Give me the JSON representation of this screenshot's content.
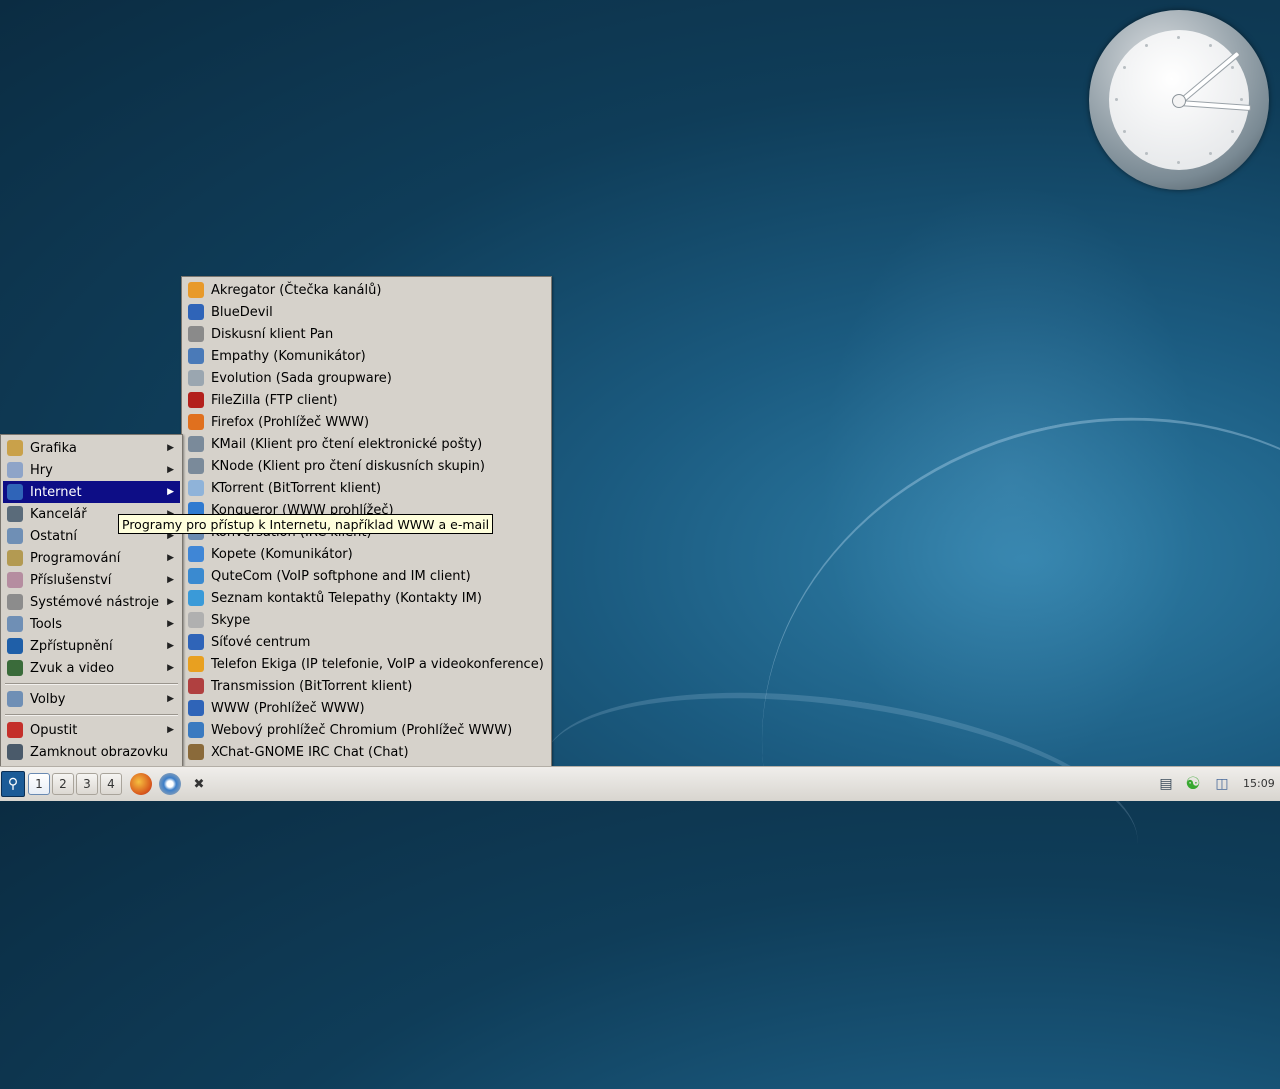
{
  "main_menu": {
    "items": [
      {
        "label": "Grafika",
        "icon": "graphics-icon",
        "color": "#c9a14a",
        "submenu": true
      },
      {
        "label": "Hry",
        "icon": "games-icon",
        "color": "#8ea4c8",
        "submenu": true
      },
      {
        "label": "Internet",
        "icon": "internet-globe-icon",
        "color": "#2f64b8",
        "submenu": true,
        "active": true
      },
      {
        "label": "Kancelář",
        "icon": "office-icon",
        "color": "#5a6b7a",
        "submenu": true
      },
      {
        "label": "Ostatní",
        "icon": "other-icon",
        "color": "#6f8fb5",
        "submenu": true
      },
      {
        "label": "Programování",
        "icon": "programming-icon",
        "color": "#b39a52",
        "submenu": true
      },
      {
        "label": "Příslušenství",
        "icon": "accessories-icon",
        "color": "#b58da0",
        "submenu": true
      },
      {
        "label": "Systémové nástroje",
        "icon": "system-tools-icon",
        "color": "#8c8c8c",
        "submenu": true
      },
      {
        "label": "Tools",
        "icon": "tools-icon",
        "color": "#6f8fb5",
        "submenu": true
      },
      {
        "label": "Zpřístupnění",
        "icon": "accessibility-icon",
        "color": "#1f5fa8",
        "submenu": true
      },
      {
        "label": "Zvuk a video",
        "icon": "multimedia-icon",
        "color": "#3a6b3a",
        "submenu": true
      }
    ],
    "settings": {
      "label": "Volby",
      "icon": "settings-icon",
      "color": "#6f8fb5"
    },
    "logout": {
      "label": "Opustit",
      "icon": "logout-icon",
      "color": "#c4302b"
    },
    "lock": {
      "label": "Zamknout obrazovku",
      "icon": "lock-screen-icon",
      "color": "#4a5a6a"
    }
  },
  "submenu": {
    "items": [
      {
        "label": "Akregator (Čtečka kanálů)",
        "icon": "akregator-icon",
        "color": "#e89a2a"
      },
      {
        "label": "BlueDevil",
        "icon": "bluetooth-icon",
        "color": "#2f64b8"
      },
      {
        "label": "Diskusní klient Pan",
        "icon": "pan-icon",
        "color": "#8a8a8a"
      },
      {
        "label": "Empathy (Komunikátor)",
        "icon": "empathy-icon",
        "color": "#4a7ab8"
      },
      {
        "label": "Evolution (Sada groupware)",
        "icon": "evolution-icon",
        "color": "#9aa6b0"
      },
      {
        "label": "FileZilla (FTP client)",
        "icon": "filezilla-icon",
        "color": "#b3201c"
      },
      {
        "label": "Firefox (Prohlížeč WWW)",
        "icon": "firefox-icon",
        "color": "#e0701e"
      },
      {
        "label": "KMail (Klient pro čtení elektronické pošty)",
        "icon": "kmail-icon",
        "color": "#7a8a9a"
      },
      {
        "label": "KNode (Klient pro čtení diskusních skupin)",
        "icon": "knode-icon",
        "color": "#7a8a9a"
      },
      {
        "label": "KTorrent (BitTorrent klient)",
        "icon": "ktorrent-icon",
        "color": "#8fb3d9"
      },
      {
        "label": "Konqueror (WWW prohlížeč)",
        "icon": "konqueror-icon",
        "color": "#2f7ad0"
      },
      {
        "label": "Konversation (IRC klient)",
        "icon": "konversation-icon",
        "color": "#6a8ab0"
      },
      {
        "label": "Kopete (Komunikátor)",
        "icon": "kopete-icon",
        "color": "#3f86d6"
      },
      {
        "label": "QuteCom (VoIP softphone and IM client)",
        "icon": "qutecom-icon",
        "color": "#3a8ad0"
      },
      {
        "label": "Seznam kontaktů Telepathy (Kontakty IM)",
        "icon": "telepathy-icon",
        "color": "#3a9ad8"
      },
      {
        "label": "Skype",
        "icon": "skype-icon",
        "color": "#b0b0b0"
      },
      {
        "label": "Síťové centrum",
        "icon": "network-center-icon",
        "color": "#2f64b8"
      },
      {
        "label": "Telefon Ekiga (IP telefonie, VoIP a videokonference)",
        "icon": "ekiga-icon",
        "color": "#e8a020"
      },
      {
        "label": "Transmission (BitTorrent klient)",
        "icon": "transmission-icon",
        "color": "#b04040"
      },
      {
        "label": "WWW (Prohlížeč WWW)",
        "icon": "www-globe-icon",
        "color": "#2f64b8"
      },
      {
        "label": "Webový prohlížeč Chromium (Prohlížeč WWW)",
        "icon": "chromium-icon",
        "color": "#3a7ac0"
      },
      {
        "label": "XChat-GNOME IRC Chat (Chat)",
        "icon": "xchat-icon",
        "color": "#8a6a3a"
      }
    ]
  },
  "tooltip": {
    "text": "Programy pro přístup k Internetu, například WWW a e-mail"
  },
  "taskbar": {
    "desktops": [
      "1",
      "2",
      "3",
      "4"
    ],
    "time": "15:09"
  }
}
